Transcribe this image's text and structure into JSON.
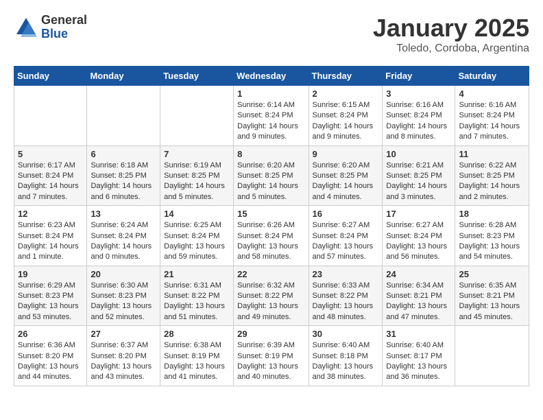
{
  "header": {
    "logo_general": "General",
    "logo_blue": "Blue",
    "month_title": "January 2025",
    "location": "Toledo, Cordoba, Argentina"
  },
  "weekdays": [
    "Sunday",
    "Monday",
    "Tuesday",
    "Wednesday",
    "Thursday",
    "Friday",
    "Saturday"
  ],
  "weeks": [
    [
      {
        "day": "",
        "info": ""
      },
      {
        "day": "",
        "info": ""
      },
      {
        "day": "",
        "info": ""
      },
      {
        "day": "1",
        "info": "Sunrise: 6:14 AM\nSunset: 8:24 PM\nDaylight: 14 hours\nand 9 minutes."
      },
      {
        "day": "2",
        "info": "Sunrise: 6:15 AM\nSunset: 8:24 PM\nDaylight: 14 hours\nand 9 minutes."
      },
      {
        "day": "3",
        "info": "Sunrise: 6:16 AM\nSunset: 8:24 PM\nDaylight: 14 hours\nand 8 minutes."
      },
      {
        "day": "4",
        "info": "Sunrise: 6:16 AM\nSunset: 8:24 PM\nDaylight: 14 hours\nand 7 minutes."
      }
    ],
    [
      {
        "day": "5",
        "info": "Sunrise: 6:17 AM\nSunset: 8:24 PM\nDaylight: 14 hours\nand 7 minutes."
      },
      {
        "day": "6",
        "info": "Sunrise: 6:18 AM\nSunset: 8:25 PM\nDaylight: 14 hours\nand 6 minutes."
      },
      {
        "day": "7",
        "info": "Sunrise: 6:19 AM\nSunset: 8:25 PM\nDaylight: 14 hours\nand 5 minutes."
      },
      {
        "day": "8",
        "info": "Sunrise: 6:20 AM\nSunset: 8:25 PM\nDaylight: 14 hours\nand 5 minutes."
      },
      {
        "day": "9",
        "info": "Sunrise: 6:20 AM\nSunset: 8:25 PM\nDaylight: 14 hours\nand 4 minutes."
      },
      {
        "day": "10",
        "info": "Sunrise: 6:21 AM\nSunset: 8:25 PM\nDaylight: 14 hours\nand 3 minutes."
      },
      {
        "day": "11",
        "info": "Sunrise: 6:22 AM\nSunset: 8:25 PM\nDaylight: 14 hours\nand 2 minutes."
      }
    ],
    [
      {
        "day": "12",
        "info": "Sunrise: 6:23 AM\nSunset: 8:24 PM\nDaylight: 14 hours\nand 1 minute."
      },
      {
        "day": "13",
        "info": "Sunrise: 6:24 AM\nSunset: 8:24 PM\nDaylight: 14 hours\nand 0 minutes."
      },
      {
        "day": "14",
        "info": "Sunrise: 6:25 AM\nSunset: 8:24 PM\nDaylight: 13 hours\nand 59 minutes."
      },
      {
        "day": "15",
        "info": "Sunrise: 6:26 AM\nSunset: 8:24 PM\nDaylight: 13 hours\nand 58 minutes."
      },
      {
        "day": "16",
        "info": "Sunrise: 6:27 AM\nSunset: 8:24 PM\nDaylight: 13 hours\nand 57 minutes."
      },
      {
        "day": "17",
        "info": "Sunrise: 6:27 AM\nSunset: 8:24 PM\nDaylight: 13 hours\nand 56 minutes."
      },
      {
        "day": "18",
        "info": "Sunrise: 6:28 AM\nSunset: 8:23 PM\nDaylight: 13 hours\nand 54 minutes."
      }
    ],
    [
      {
        "day": "19",
        "info": "Sunrise: 6:29 AM\nSunset: 8:23 PM\nDaylight: 13 hours\nand 53 minutes."
      },
      {
        "day": "20",
        "info": "Sunrise: 6:30 AM\nSunset: 8:23 PM\nDaylight: 13 hours\nand 52 minutes."
      },
      {
        "day": "21",
        "info": "Sunrise: 6:31 AM\nSunset: 8:22 PM\nDaylight: 13 hours\nand 51 minutes."
      },
      {
        "day": "22",
        "info": "Sunrise: 6:32 AM\nSunset: 8:22 PM\nDaylight: 13 hours\nand 49 minutes."
      },
      {
        "day": "23",
        "info": "Sunrise: 6:33 AM\nSunset: 8:22 PM\nDaylight: 13 hours\nand 48 minutes."
      },
      {
        "day": "24",
        "info": "Sunrise: 6:34 AM\nSunset: 8:21 PM\nDaylight: 13 hours\nand 47 minutes."
      },
      {
        "day": "25",
        "info": "Sunrise: 6:35 AM\nSunset: 8:21 PM\nDaylight: 13 hours\nand 45 minutes."
      }
    ],
    [
      {
        "day": "26",
        "info": "Sunrise: 6:36 AM\nSunset: 8:20 PM\nDaylight: 13 hours\nand 44 minutes."
      },
      {
        "day": "27",
        "info": "Sunrise: 6:37 AM\nSunset: 8:20 PM\nDaylight: 13 hours\nand 43 minutes."
      },
      {
        "day": "28",
        "info": "Sunrise: 6:38 AM\nSunset: 8:19 PM\nDaylight: 13 hours\nand 41 minutes."
      },
      {
        "day": "29",
        "info": "Sunrise: 6:39 AM\nSunset: 8:19 PM\nDaylight: 13 hours\nand 40 minutes."
      },
      {
        "day": "30",
        "info": "Sunrise: 6:40 AM\nSunset: 8:18 PM\nDaylight: 13 hours\nand 38 minutes."
      },
      {
        "day": "31",
        "info": "Sunrise: 6:40 AM\nSunset: 8:17 PM\nDaylight: 13 hours\nand 36 minutes."
      },
      {
        "day": "",
        "info": ""
      }
    ]
  ]
}
